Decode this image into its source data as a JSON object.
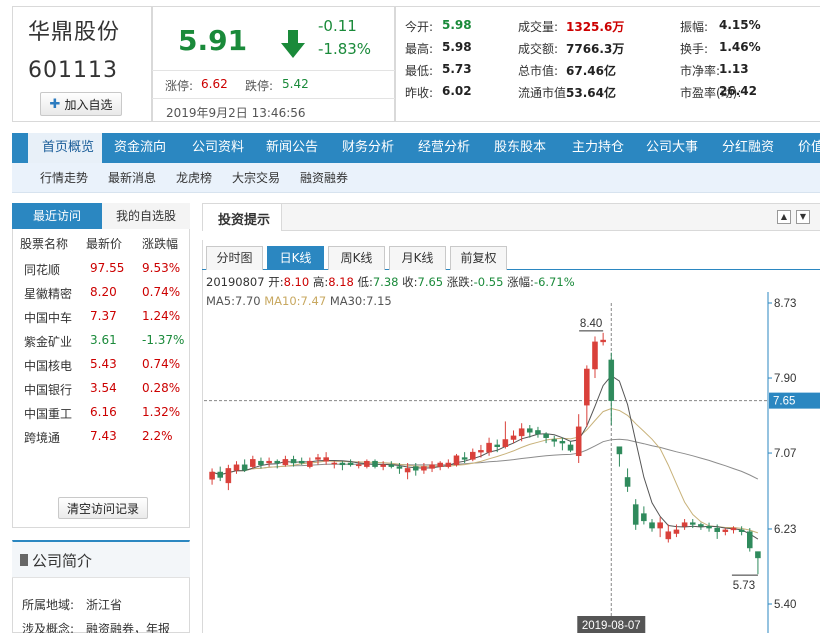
{
  "header": {
    "stock_name": "华鼎股份",
    "stock_code": "601113",
    "add_fav_label": "加入自选",
    "price": "5.91",
    "change": "-0.11",
    "change_pct": "-1.83%",
    "limit_up_label": "涨停:",
    "limit_up": "6.62",
    "limit_down_label": "跌停:",
    "limit_down": "5.42",
    "datetime": "2019年9月2日 13:46:56"
  },
  "quote": [
    [
      {
        "k": "今开:",
        "v": "5.98",
        "c": "green"
      },
      {
        "k": "成交量:",
        "v": "1325.6万",
        "c": "red"
      },
      {
        "k": "振幅:",
        "v": "4.15%",
        "c": "dark"
      }
    ],
    [
      {
        "k": "最高:",
        "v": "5.98",
        "c": "dark"
      },
      {
        "k": "成交额:",
        "v": "7766.3万",
        "c": "dark"
      },
      {
        "k": "换手:",
        "v": "1.46%",
        "c": "dark"
      }
    ],
    [
      {
        "k": "最低:",
        "v": "5.73",
        "c": "dark"
      },
      {
        "k": "总市值:",
        "v": "67.46亿",
        "c": "dark"
      },
      {
        "k": "市净率:",
        "v": "1.13",
        "c": "dark"
      }
    ],
    [
      {
        "k": "昨收:",
        "v": "6.02",
        "c": "dark"
      },
      {
        "k": "流通市值:",
        "v": "53.64亿",
        "c": "dark"
      },
      {
        "k": "市盈率(动):",
        "v": "26.42",
        "c": "dark"
      }
    ]
  ],
  "nav": [
    "首页概览",
    "资金流向",
    "公司资料",
    "新闻公告",
    "财务分析",
    "经营分析",
    "股东股本",
    "主力持仓",
    "公司大事",
    "分红融资",
    "价值"
  ],
  "subnav": [
    "行情走势",
    "最新消息",
    "龙虎榜",
    "大宗交易",
    "融资融券"
  ],
  "sidebar": {
    "tab_recent": "最近访问",
    "tab_fav": "我的自选股",
    "headers": [
      "股票名称",
      "最新价",
      "涨跌幅"
    ],
    "rows": [
      {
        "name": "同花顺",
        "price": "97.55",
        "pct": "9.53%",
        "color": "red"
      },
      {
        "name": "星徽精密",
        "price": "8.20",
        "pct": "0.74%",
        "color": "red"
      },
      {
        "name": "中国中车",
        "price": "7.37",
        "pct": "1.24%",
        "color": "red"
      },
      {
        "name": "紫金矿业",
        "price": "3.61",
        "pct": "-1.37%",
        "color": "green"
      },
      {
        "name": "中国核电",
        "price": "5.43",
        "pct": "0.74%",
        "color": "red"
      },
      {
        "name": "中国银行",
        "price": "3.54",
        "pct": "0.28%",
        "color": "red"
      },
      {
        "name": "中国重工",
        "price": "6.16",
        "pct": "1.32%",
        "color": "red"
      },
      {
        "name": "跨境通",
        "price": "7.43",
        "pct": "2.2%",
        "color": "red"
      }
    ],
    "clear_label": "清空访问记录",
    "profile_title": "公司简介",
    "profile_region_label": "所属地域:",
    "profile_region": "浙江省",
    "profile_concept_label": "涉及概念:",
    "profile_concept": "融资融券，年报"
  },
  "tips_title": "投资提示",
  "chart_tabs": [
    "分时图",
    "日K线",
    "周K线",
    "月K线",
    "前复权"
  ],
  "active_chart_tab": 1,
  "info": {
    "date": "20190807",
    "open_label": "开:",
    "open": "8.10",
    "high_label": "高:",
    "high": "8.18",
    "low_label": "低:",
    "low": "7.38",
    "close_label": "收:",
    "close": "7.65",
    "chg_label": "涨跌:",
    "chg": "-0.55",
    "pct_label": "涨幅:",
    "pct": "-6.71%"
  },
  "ma": {
    "ma5_label": "MA5:",
    "ma5": "7.70",
    "ma10_label": "MA10:",
    "ma10": "7.47",
    "ma30_label": "MA30:",
    "ma30": "7.15"
  },
  "chart_data": {
    "type": "candlestick",
    "ylim": [
      5.4,
      8.73
    ],
    "y_ticks": [
      "8.73",
      "7.90",
      "7.07",
      "6.23",
      "5.40"
    ],
    "crosshair_date": "2019-08-07",
    "crosshair_value": "7.65",
    "max_label": "8.40",
    "min_label": "5.73",
    "colors": {
      "up": "#d9403a",
      "down": "#2f8a5c",
      "ma5": "#555555",
      "ma10": "#c8b27a",
      "ma30": "#8c8c8c",
      "axis": "#2b87c1"
    },
    "candles": [
      {
        "o": 6.78,
        "c": 6.86,
        "h": 6.9,
        "l": 6.72
      },
      {
        "o": 6.86,
        "c": 6.8,
        "h": 6.92,
        "l": 6.76
      },
      {
        "o": 6.74,
        "c": 6.9,
        "h": 6.94,
        "l": 6.66
      },
      {
        "o": 6.88,
        "c": 6.94,
        "h": 6.98,
        "l": 6.84
      },
      {
        "o": 6.94,
        "c": 6.88,
        "h": 7.0,
        "l": 6.86
      },
      {
        "o": 6.92,
        "c": 7.0,
        "h": 7.04,
        "l": 6.9
      },
      {
        "o": 6.98,
        "c": 6.94,
        "h": 7.02,
        "l": 6.9
      },
      {
        "o": 6.96,
        "c": 6.98,
        "h": 7.02,
        "l": 6.92
      },
      {
        "o": 6.98,
        "c": 6.96,
        "h": 7.0,
        "l": 6.9
      },
      {
        "o": 6.94,
        "c": 7.0,
        "h": 7.04,
        "l": 6.92
      },
      {
        "o": 7.0,
        "c": 6.96,
        "h": 7.04,
        "l": 6.92
      },
      {
        "o": 6.98,
        "c": 6.96,
        "h": 7.02,
        "l": 6.94
      },
      {
        "o": 6.92,
        "c": 6.98,
        "h": 7.02,
        "l": 6.9
      },
      {
        "o": 7.0,
        "c": 7.02,
        "h": 7.06,
        "l": 6.94
      },
      {
        "o": 6.98,
        "c": 7.02,
        "h": 7.08,
        "l": 6.94
      },
      {
        "o": 6.96,
        "c": 6.96,
        "h": 6.98,
        "l": 6.9
      },
      {
        "o": 6.96,
        "c": 6.94,
        "h": 6.98,
        "l": 6.88
      },
      {
        "o": 6.96,
        "c": 6.94,
        "h": 7.0,
        "l": 6.92
      },
      {
        "o": 6.94,
        "c": 6.94,
        "h": 6.98,
        "l": 6.9
      },
      {
        "o": 6.92,
        "c": 6.98,
        "h": 7.0,
        "l": 6.9
      },
      {
        "o": 6.98,
        "c": 6.92,
        "h": 7.0,
        "l": 6.9
      },
      {
        "o": 6.92,
        "c": 6.94,
        "h": 6.98,
        "l": 6.88
      },
      {
        "o": 6.94,
        "c": 6.92,
        "h": 6.98,
        "l": 6.9
      },
      {
        "o": 6.92,
        "c": 6.9,
        "h": 6.96,
        "l": 6.84
      },
      {
        "o": 6.86,
        "c": 6.9,
        "h": 6.96,
        "l": 6.78
      },
      {
        "o": 6.92,
        "c": 6.88,
        "h": 6.96,
        "l": 6.82
      },
      {
        "o": 6.88,
        "c": 6.92,
        "h": 6.96,
        "l": 6.84
      },
      {
        "o": 6.9,
        "c": 6.94,
        "h": 6.98,
        "l": 6.86
      },
      {
        "o": 6.92,
        "c": 6.96,
        "h": 6.98,
        "l": 6.88
      },
      {
        "o": 6.92,
        "c": 6.96,
        "h": 7.0,
        "l": 6.9
      },
      {
        "o": 6.94,
        "c": 7.04,
        "h": 7.06,
        "l": 6.92
      },
      {
        "o": 7.02,
        "c": 7.0,
        "h": 7.08,
        "l": 6.96
      },
      {
        "o": 7.0,
        "c": 7.08,
        "h": 7.12,
        "l": 6.98
      },
      {
        "o": 7.08,
        "c": 7.1,
        "h": 7.16,
        "l": 7.02
      },
      {
        "o": 7.08,
        "c": 7.18,
        "h": 7.24,
        "l": 7.04
      },
      {
        "o": 7.16,
        "c": 7.14,
        "h": 7.22,
        "l": 7.08
      },
      {
        "o": 7.14,
        "c": 7.22,
        "h": 7.42,
        "l": 7.12
      },
      {
        "o": 7.22,
        "c": 7.26,
        "h": 7.32,
        "l": 7.18
      },
      {
        "o": 7.26,
        "c": 7.34,
        "h": 7.4,
        "l": 7.2
      },
      {
        "o": 7.34,
        "c": 7.3,
        "h": 7.38,
        "l": 7.24
      },
      {
        "o": 7.32,
        "c": 7.28,
        "h": 7.36,
        "l": 7.24
      },
      {
        "o": 7.28,
        "c": 7.24,
        "h": 7.3,
        "l": 7.18
      },
      {
        "o": 7.22,
        "c": 7.2,
        "h": 7.26,
        "l": 7.14
      },
      {
        "o": 7.2,
        "c": 7.18,
        "h": 7.24,
        "l": 7.1
      },
      {
        "o": 7.16,
        "c": 7.1,
        "h": 7.2,
        "l": 7.08
      },
      {
        "o": 7.04,
        "c": 7.36,
        "h": 7.5,
        "l": 6.96
      },
      {
        "o": 7.6,
        "c": 8.0,
        "h": 8.04,
        "l": 7.36
      },
      {
        "o": 8.0,
        "c": 8.3,
        "h": 8.36,
        "l": 7.9
      },
      {
        "o": 8.3,
        "c": 8.32,
        "h": 8.4,
        "l": 8.26
      },
      {
        "o": 8.1,
        "c": 7.65,
        "h": 8.18,
        "l": 7.38
      },
      {
        "o": 7.14,
        "c": 7.06,
        "h": 7.1,
        "l": 6.92
      },
      {
        "o": 6.8,
        "c": 6.7,
        "h": 6.9,
        "l": 6.64
      },
      {
        "o": 6.5,
        "c": 6.28,
        "h": 6.56,
        "l": 6.22
      },
      {
        "o": 6.4,
        "c": 6.32,
        "h": 6.48,
        "l": 6.28
      },
      {
        "o": 6.3,
        "c": 6.24,
        "h": 6.34,
        "l": 6.2
      },
      {
        "o": 6.24,
        "c": 6.3,
        "h": 6.36,
        "l": 6.14
      },
      {
        "o": 6.12,
        "c": 6.2,
        "h": 6.28,
        "l": 6.08
      },
      {
        "o": 6.18,
        "c": 6.22,
        "h": 6.28,
        "l": 6.14
      },
      {
        "o": 6.26,
        "c": 6.3,
        "h": 6.34,
        "l": 6.22
      },
      {
        "o": 6.3,
        "c": 6.28,
        "h": 6.34,
        "l": 6.24
      },
      {
        "o": 6.28,
        "c": 6.26,
        "h": 6.3,
        "l": 6.22
      },
      {
        "o": 6.26,
        "c": 6.24,
        "h": 6.3,
        "l": 6.2
      },
      {
        "o": 6.24,
        "c": 6.2,
        "h": 6.28,
        "l": 6.12
      },
      {
        "o": 6.2,
        "c": 6.22,
        "h": 6.24,
        "l": 6.16
      },
      {
        "o": 6.22,
        "c": 6.24,
        "h": 6.26,
        "l": 6.18
      },
      {
        "o": 6.22,
        "c": 6.2,
        "h": 6.26,
        "l": 6.16
      },
      {
        "o": 6.2,
        "c": 6.02,
        "h": 6.24,
        "l": 5.98
      },
      {
        "o": 5.98,
        "c": 5.91,
        "h": 5.98,
        "l": 5.73
      }
    ]
  }
}
